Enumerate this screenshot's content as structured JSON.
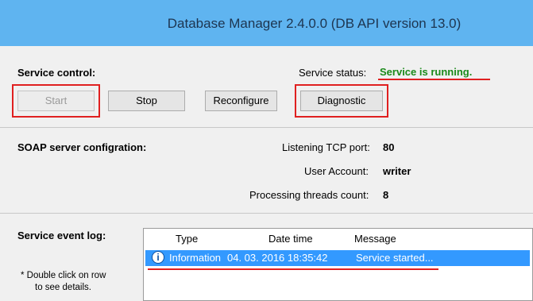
{
  "window": {
    "title": "Database Manager  2.4.0.0  (DB API version 13.0)"
  },
  "service_control": {
    "heading": "Service control:",
    "status_label": "Service status:",
    "status_value": "Service is running.",
    "status_color": "#1a8a1a",
    "buttons": {
      "start": "Start",
      "stop": "Stop",
      "reconfigure": "Reconfigure",
      "diagnostic": "Diagnostic"
    }
  },
  "soap": {
    "heading": "SOAP server configration:",
    "port_label": "Listening TCP port:",
    "port_value": "80",
    "account_label": "User Account:",
    "account_value": "writer",
    "threads_label": "Processing threads count:",
    "threads_value": "8"
  },
  "event_log": {
    "heading": "Service event log:",
    "hint_line1": "* Double click on row",
    "hint_line2": "to see details.",
    "columns": [
      "Type",
      "Date time",
      "Message"
    ],
    "rows": [
      {
        "icon": "info-icon",
        "type": "Information",
        "datetime": "04. 03. 2016  18:35:42",
        "message": "Service started..."
      }
    ]
  },
  "colors": {
    "title_bar": "#5fb4f0",
    "highlight": "#e02020",
    "selected_row": "#3399ff"
  }
}
